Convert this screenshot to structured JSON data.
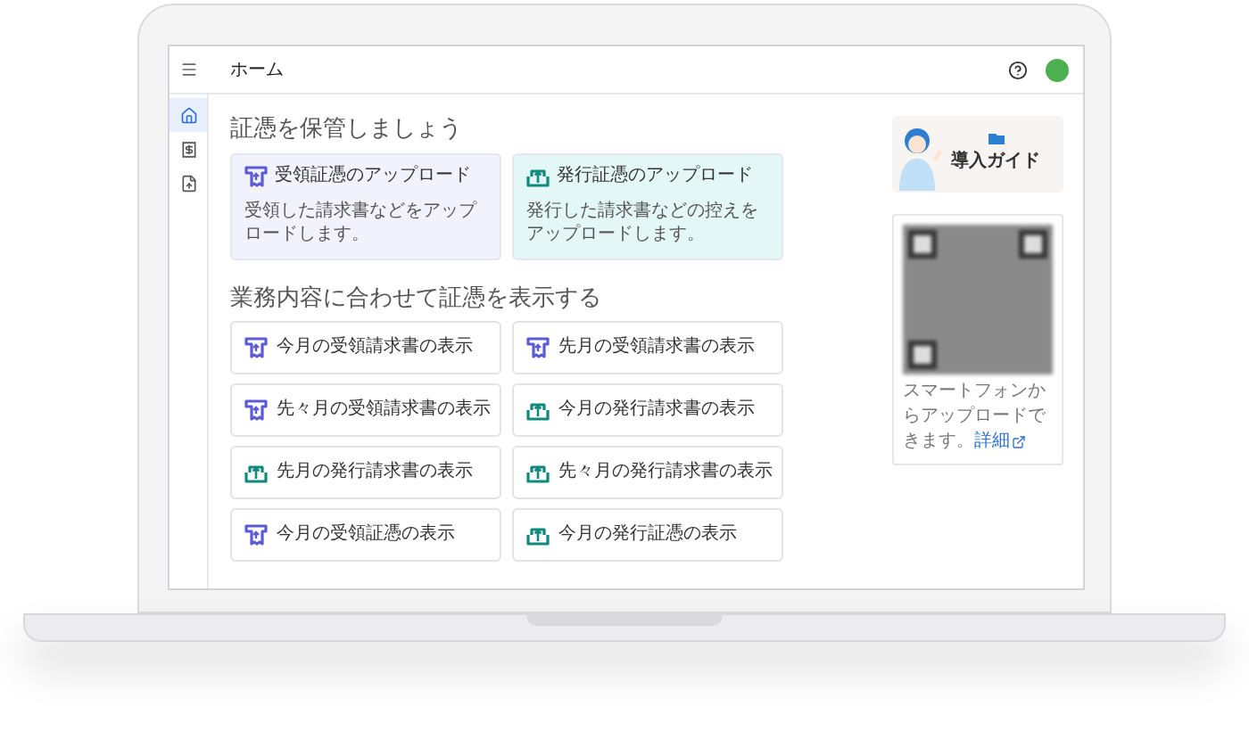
{
  "header": {
    "title": "ホーム"
  },
  "sidebar": {
    "items": [
      {
        "selected": true
      },
      {
        "selected": false
      },
      {
        "selected": false
      }
    ]
  },
  "upload_section": {
    "heading": "証憑を保管しましょう",
    "cards": [
      {
        "kind": "received",
        "title": "受領証憑のアップロード",
        "description": "受領した請求書などをアップロードします。"
      },
      {
        "kind": "issued",
        "title": "発行証憑のアップロード",
        "description": "発行した請求書などの控えをアップロードします。"
      }
    ]
  },
  "view_section": {
    "heading": "業務内容に合わせて証憑を表示する",
    "buttons": [
      {
        "kind": "received",
        "label": "今月の受領請求書の表示"
      },
      {
        "kind": "received",
        "label": "先月の受領請求書の表示"
      },
      {
        "kind": "received",
        "label": "先々月の受領請求書の表示"
      },
      {
        "kind": "issued",
        "label": "今月の発行請求書の表示"
      },
      {
        "kind": "issued",
        "label": "先月の発行請求書の表示"
      },
      {
        "kind": "issued",
        "label": "先々月の発行請求書の表示"
      },
      {
        "kind": "received",
        "label": "今月の受領証憑の表示"
      },
      {
        "kind": "issued",
        "label": "今月の発行証憑の表示"
      }
    ]
  },
  "guide": {
    "label": "導入ガイド"
  },
  "qr": {
    "caption": "スマートフォンからアップロードできます。",
    "link": "詳細"
  }
}
